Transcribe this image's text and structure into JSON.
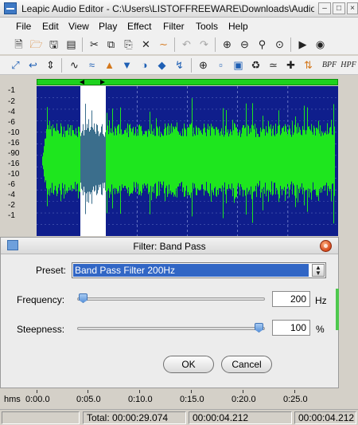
{
  "window": {
    "title": "Leapic Audio Editor - C:\\Users\\LISTOFFREEWARE\\Downloads\\Audio Filter..."
  },
  "menu": [
    "File",
    "Edit",
    "View",
    "Play",
    "Effect",
    "Filter",
    "Tools",
    "Help"
  ],
  "amplitude_scale": [
    "-1",
    "-2",
    "-4",
    "-6",
    "-10",
    "-16",
    "-90",
    "-16",
    "-10",
    "-6",
    "-4",
    "-2",
    "-1"
  ],
  "filter_dialog": {
    "title": "Filter: Band Pass",
    "preset_label": "Preset:",
    "preset_value": "Band Pass Filter 200Hz",
    "frequency_label": "Frequency:",
    "frequency_value": "200",
    "frequency_unit": "Hz",
    "frequency_level": 0,
    "steepness_label": "Steepness:",
    "steepness_value": "100",
    "steepness_unit": "%",
    "steepness_level": 1,
    "ok_label": "OK",
    "cancel_label": "Cancel"
  },
  "timeline": {
    "unit": "hms",
    "ticks": [
      "0:00.0",
      "0:05.0",
      "0:10.0",
      "0:15.0",
      "0:20.0",
      "0:25.0"
    ]
  },
  "status": {
    "total": "Total: 00:00:29.074",
    "position": "00:00:04.212",
    "selection": "00:00:04.212"
  },
  "colors": {
    "waveform": "#1ee61e",
    "waveform_selected": "#3b6e8c",
    "background": "#0f1e8c",
    "selection": "#ffffff"
  },
  "icons": {
    "toolbar1": [
      "new-file-icon",
      "open-folder-icon",
      "save-icon",
      "save-as-icon",
      "cut-icon",
      "copy-icon",
      "paste-icon",
      "delete-icon",
      "trim-icon",
      "undo-icon",
      "redo-icon",
      "zoom-in-icon",
      "zoom-out-icon",
      "zoom-selection-icon",
      "zoom-fit-icon",
      "play-icon",
      "record-icon"
    ],
    "toolbar2": [
      "move-icon",
      "back-icon",
      "insert-icon",
      "amplify-icon",
      "normalize-icon",
      "fade-in-icon",
      "fade-out-icon",
      "compressor-icon",
      "echo-icon",
      "reverse-icon",
      "invert-icon",
      "silence-icon",
      "noise-icon",
      "equalizer-icon",
      "swap-icon",
      "channels-icon",
      "bandpass-filter-icon",
      "highpass-filter-icon"
    ]
  },
  "toolbar2_labels": {
    "bpf": "BPF",
    "hpf": "HPF"
  }
}
